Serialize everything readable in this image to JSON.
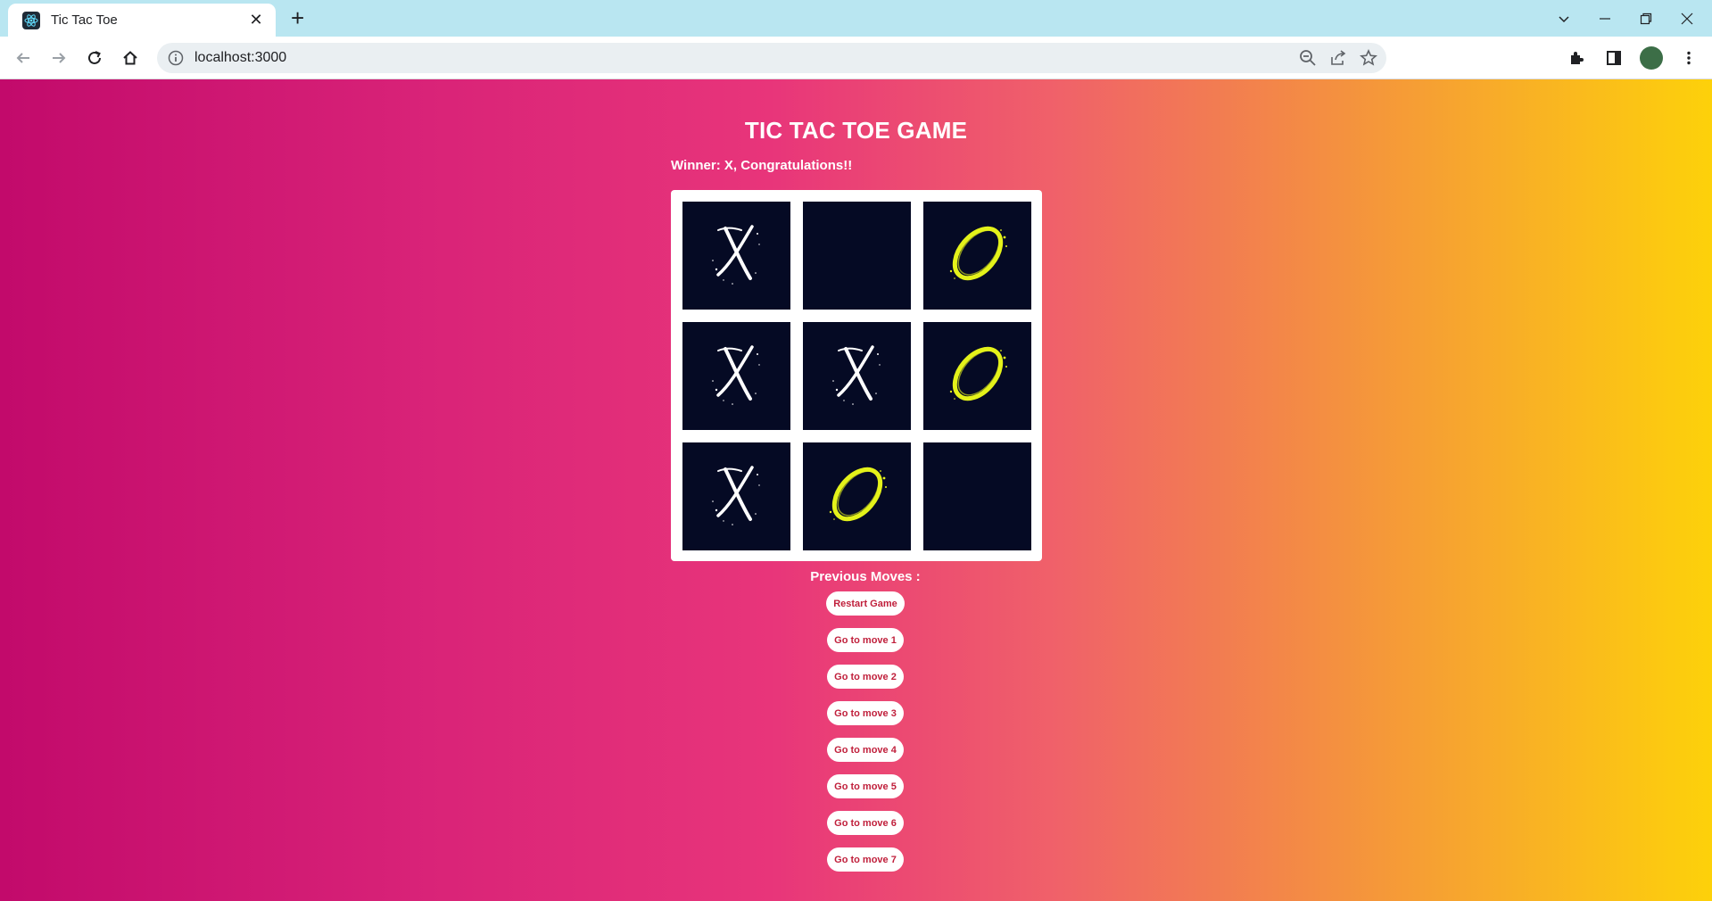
{
  "browser": {
    "tab_title": "Tic Tac Toe",
    "url": "localhost:3000"
  },
  "game": {
    "title": "TIC TAC TOE GAME",
    "status": "Winner: X, Congratulations!!",
    "board": [
      "X",
      "",
      "O",
      "X",
      "X",
      "O",
      "X",
      "O",
      ""
    ],
    "colors": {
      "x": "#ffffff",
      "o": "#e4f21a",
      "cell": "#050a24"
    }
  },
  "history": {
    "label": "Previous Moves :",
    "restart_label": "Restart Game",
    "moves": [
      "Go to move 1",
      "Go to move 2",
      "Go to move 3",
      "Go to move 4",
      "Go to move 5",
      "Go to move 6",
      "Go to move 7"
    ]
  }
}
